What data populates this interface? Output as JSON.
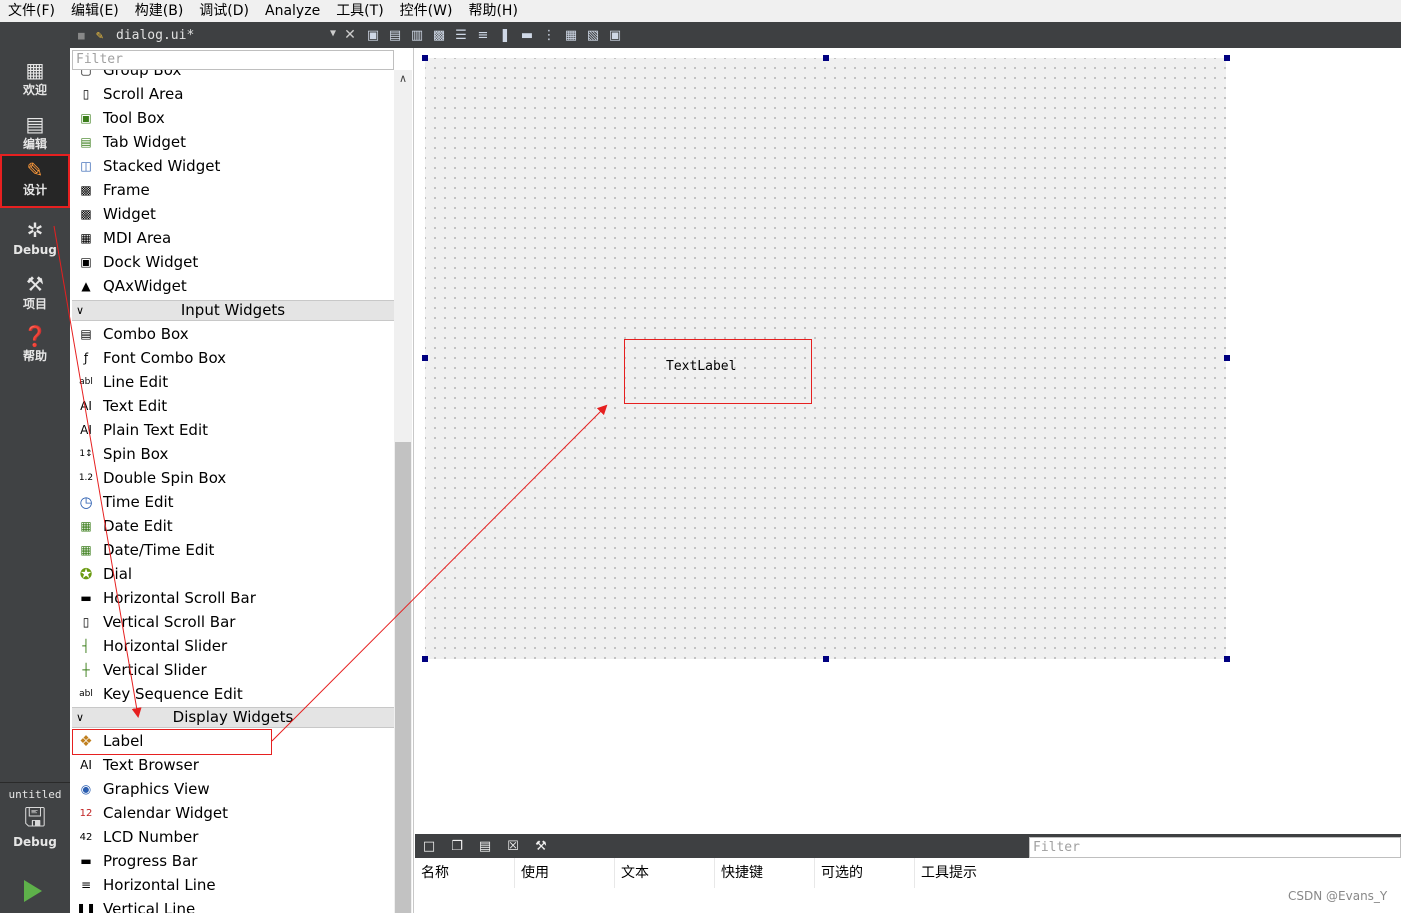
{
  "menubar": [
    "文件(F)",
    "编辑(E)",
    "构建(B)",
    "调试(D)",
    "Analyze",
    "工具(T)",
    "控件(W)",
    "帮助(H)"
  ],
  "modes": [
    {
      "label": "欢迎",
      "icon": "grid-icon"
    },
    {
      "label": "编辑",
      "icon": "document-icon"
    },
    {
      "label": "设计",
      "icon": "pencil-icon"
    },
    {
      "label": "Debug",
      "icon": "bug-icon"
    },
    {
      "label": "项目",
      "icon": "wrench-icon"
    },
    {
      "label": "帮助",
      "icon": "help-icon"
    }
  ],
  "target": {
    "name": "untitled",
    "mode": "Debug"
  },
  "document": {
    "name": "dialog.ui*"
  },
  "widgetbox": {
    "filter_placeholder": "Filter",
    "partial_top": "Group Box",
    "containers": [
      "Scroll Area",
      "Tool Box",
      "Tab Widget",
      "Stacked Widget",
      "Frame",
      "Widget",
      "MDI Area",
      "Dock Widget",
      "QAxWidget"
    ],
    "input_category": "Input Widgets",
    "input": [
      "Combo Box",
      "Font Combo Box",
      "Line Edit",
      "Text Edit",
      "Plain Text Edit",
      "Spin Box",
      "Double Spin Box",
      "Time Edit",
      "Date Edit",
      "Date/Time Edit",
      "Dial",
      "Horizontal Scroll Bar",
      "Vertical Scroll Bar",
      "Horizontal Slider",
      "Vertical Slider",
      "Key Sequence Edit"
    ],
    "display_category": "Display Widgets",
    "display": [
      "Label",
      "Text Browser",
      "Graphics View",
      "Calendar Widget",
      "LCD Number",
      "Progress Bar",
      "Horizontal Line",
      "Vertical Line"
    ]
  },
  "form": {
    "label_text": "TextLabel"
  },
  "action_editor": {
    "filter_placeholder": "Filter",
    "columns": [
      "名称",
      "使用",
      "文本",
      "快捷键",
      "可选的",
      "工具提示"
    ]
  },
  "watermark": "CSDN @Evans_Y",
  "colors": {
    "annotation": "#e62020",
    "sidebar": "#404244",
    "handle": "#000080"
  }
}
